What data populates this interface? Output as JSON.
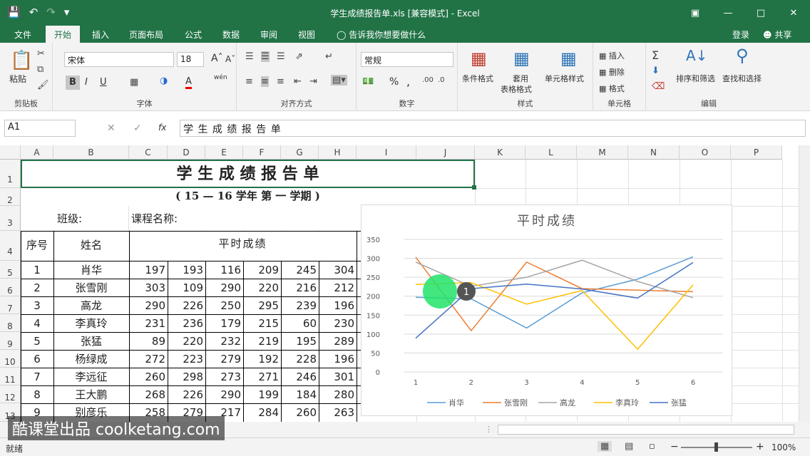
{
  "window": {
    "title": "学生成绩报告单.xls  [兼容模式] - Excel",
    "qat": [
      "save-icon",
      "undo-icon",
      "redo-icon",
      "customize-icon"
    ]
  },
  "tabs": [
    "文件",
    "开始",
    "插入",
    "页面布局",
    "公式",
    "数据",
    "审阅",
    "视图"
  ],
  "tellme": "告诉我你想要做什么",
  "login": "登录",
  "share": "共享",
  "ribbon": {
    "clipboard": {
      "label": "剪贴板",
      "paste": "粘贴"
    },
    "font": {
      "label": "字体",
      "name": "宋体",
      "size": "18",
      "bold": "B",
      "italic": "I",
      "underline": "U",
      "wen": "wén"
    },
    "align": {
      "label": "对齐方式"
    },
    "number": {
      "label": "数字",
      "format": "常规",
      "percent": "%",
      "comma": ","
    },
    "styles": {
      "label": "样式",
      "cond": "条件格式",
      "table1": "套用",
      "table2": "表格格式",
      "cell": "单元格样式"
    },
    "cells": {
      "label": "单元格",
      "insert": "插入",
      "delete": "删除",
      "format": "格式"
    },
    "edit": {
      "label": "编辑",
      "sort": "排序和筛选",
      "find": "查找和选择"
    }
  },
  "formula_bar": {
    "name_box": "A1",
    "fx": "fx",
    "content": "学 生 成 绩 报 告 单"
  },
  "columns": [
    "A",
    "B",
    "C",
    "D",
    "E",
    "F",
    "G",
    "H",
    "I",
    "J",
    "K",
    "L",
    "M",
    "N",
    "O",
    "P"
  ],
  "rows": [
    "1",
    "2",
    "3",
    "4",
    "5",
    "6",
    "7",
    "8",
    "9",
    "10",
    "11",
    "12",
    "13"
  ],
  "sheet": {
    "title": "学 生 成 绩 报 告 单",
    "subtitle": "( 15 — 16   学年 第 一 学期 )",
    "class_label": "班级:",
    "course_label": "课程名称:",
    "hdr_no": "序号",
    "hdr_name": "姓名",
    "hdr_scores": "平时成绩",
    "records": [
      {
        "no": "1",
        "name": "肖华",
        "scores": [
          "197",
          "193",
          "116",
          "209",
          "245",
          "304"
        ]
      },
      {
        "no": "2",
        "name": "张雪刚",
        "scores": [
          "303",
          "109",
          "290",
          "220",
          "216",
          "212"
        ]
      },
      {
        "no": "3",
        "name": "高龙",
        "scores": [
          "290",
          "226",
          "250",
          "295",
          "239",
          "196"
        ]
      },
      {
        "no": "4",
        "name": "李真玲",
        "scores": [
          "231",
          "236",
          "179",
          "215",
          "60",
          "230"
        ]
      },
      {
        "no": "5",
        "name": "张猛",
        "scores": [
          "89",
          "220",
          "232",
          "219",
          "195",
          "289"
        ]
      },
      {
        "no": "6",
        "name": "杨绿成",
        "scores": [
          "272",
          "223",
          "279",
          "192",
          "228",
          "196"
        ]
      },
      {
        "no": "7",
        "name": "李远征",
        "scores": [
          "260",
          "298",
          "273",
          "271",
          "246",
          "301"
        ]
      },
      {
        "no": "8",
        "name": "王大鹏",
        "scores": [
          "268",
          "226",
          "290",
          "199",
          "184",
          "280"
        ]
      },
      {
        "no": "9",
        "name": "别彦乐",
        "scores": [
          "258",
          "279",
          "217",
          "284",
          "260",
          "263"
        ]
      }
    ]
  },
  "chart_data": {
    "type": "line",
    "title": "平时成绩",
    "x": [
      1,
      2,
      3,
      4,
      5,
      6
    ],
    "ylim": [
      0,
      350
    ],
    "yticks": [
      0,
      50,
      100,
      150,
      200,
      250,
      300,
      350
    ],
    "grid": true,
    "legend": "bottom",
    "series": [
      {
        "name": "肖华",
        "color": "#5b9bd5",
        "values": [
          197,
          193,
          116,
          209,
          245,
          304
        ]
      },
      {
        "name": "张雪刚",
        "color": "#ed7d31",
        "values": [
          303,
          109,
          290,
          220,
          216,
          212
        ]
      },
      {
        "name": "高龙",
        "color": "#a5a5a5",
        "values": [
          290,
          226,
          250,
          295,
          239,
          196
        ]
      },
      {
        "name": "李真玲",
        "color": "#ffc000",
        "values": [
          231,
          236,
          179,
          215,
          60,
          230
        ]
      },
      {
        "name": "张猛",
        "color": "#4472c4",
        "values": [
          89,
          220,
          232,
          219,
          195,
          289
        ]
      }
    ]
  },
  "cursor_badge": "1",
  "status": {
    "ready": "就绪",
    "zoom": "100%"
  },
  "watermark": "酷课堂出品 coolketang.com"
}
